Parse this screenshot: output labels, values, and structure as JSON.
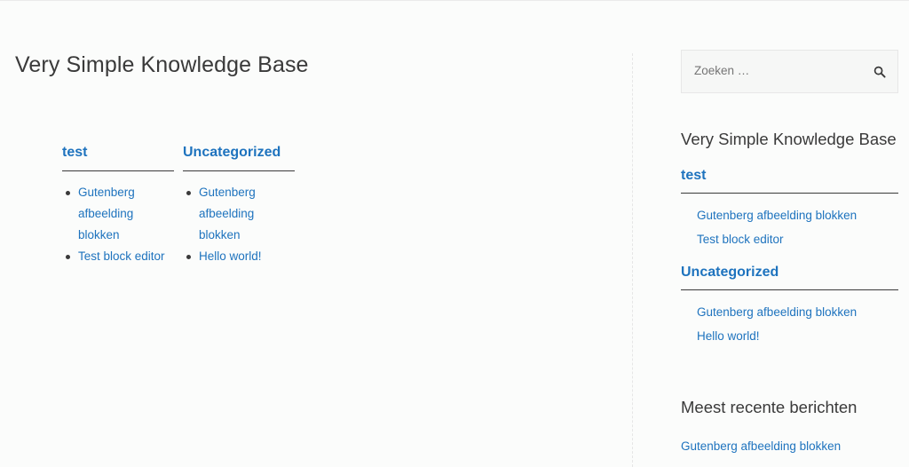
{
  "main": {
    "title": "Very Simple Knowledge Base",
    "categories": [
      {
        "title": "test",
        "posts": [
          "Gutenberg afbeelding blokken",
          "Test block editor"
        ]
      },
      {
        "title": "Uncategorized",
        "posts": [
          "Gutenberg afbeelding blokken",
          "Hello world!"
        ]
      }
    ]
  },
  "sidebar": {
    "search": {
      "placeholder": "Zoeken …",
      "icon": "search-icon"
    },
    "kb_widget": {
      "title": "Very Simple Knowledge Base",
      "categories": [
        {
          "title": "test",
          "posts": [
            "Gutenberg afbeelding blokken",
            "Test block editor"
          ]
        },
        {
          "title": "Uncategorized",
          "posts": [
            "Gutenberg afbeelding blokken",
            "Hello world!"
          ]
        }
      ]
    },
    "recent_posts": {
      "title": "Meest recente berichten",
      "items": [
        "Gutenberg afbeelding blokken"
      ]
    }
  },
  "colors": {
    "link": "#1e73be",
    "text": "#3a3a3a",
    "background": "#fbfcfb"
  }
}
